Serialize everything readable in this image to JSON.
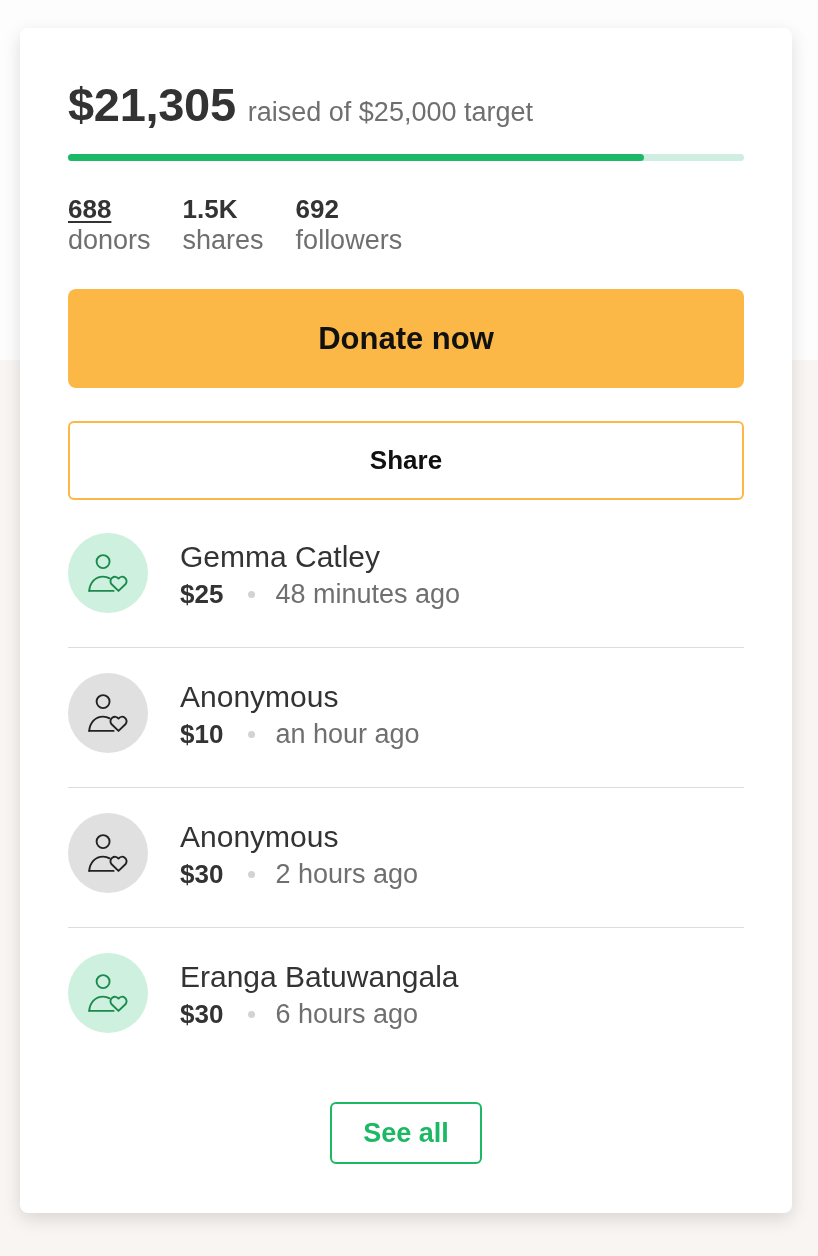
{
  "summary": {
    "raised": "$21,305",
    "caption": "raised of $25,000 target"
  },
  "progress": {
    "level": 0.852
  },
  "stats": [
    {
      "value": "688",
      "label": "donors",
      "link": true
    },
    {
      "value": "1.5K",
      "label": "shares",
      "link": false
    },
    {
      "value": "692",
      "label": "followers",
      "link": false
    }
  ],
  "buttons": [
    {
      "label": "Donate now",
      "kind": "primary"
    },
    {
      "label": "Share",
      "kind": "outline"
    }
  ],
  "donors": [
    {
      "name": "Gemma Catley",
      "amount": "$25",
      "time": "48 minutes ago",
      "color": "#cdf0df"
    },
    {
      "name": "Anonymous",
      "amount": "$10",
      "time": "an hour ago",
      "color": "#e0e0e0"
    },
    {
      "name": "Anonymous",
      "amount": "$30",
      "time": "2 hours ago",
      "color": "#e0e0e0"
    },
    {
      "name": "Eranga Batuwangala",
      "amount": "$30",
      "time": "6 hours ago",
      "color": "#cdf0df"
    }
  ],
  "see_all": {
    "label": "See all"
  }
}
